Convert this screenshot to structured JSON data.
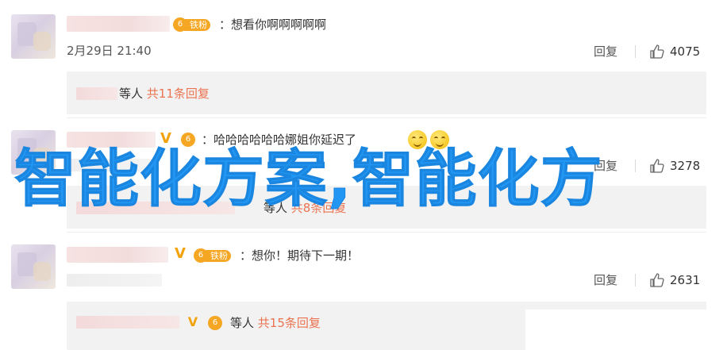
{
  "comments": [
    {
      "text": "：想看你啊啊啊啊啊",
      "time": "2月29日 21:40",
      "reply_label": "回复",
      "likes": "4075",
      "badge": "铁粉",
      "sub_replies": {
        "prefix": "等人",
        "count_text": "共11条回复"
      }
    },
    {
      "text": "：哈哈哈哈哈哈娜姐你延迟了",
      "reply_label": "回复",
      "likes": "3278",
      "sub_replies": {
        "prefix": "等人",
        "count_text": "共8条回复"
      }
    },
    {
      "text": "：想你！期待下一期！",
      "reply_label": "回复",
      "likes": "2631",
      "badge": "铁粉",
      "sub_replies": {
        "prefix": "等人",
        "count_text": "共15条回复"
      }
    }
  ],
  "watermark": "智能化方案,智能化方",
  "colors": {
    "watermark": "#2196f3",
    "reply_count": "#eb7350",
    "badge": "#f5a623",
    "verified": "#f2a20c"
  },
  "icons": [
    "verified-v-icon",
    "fan-badge-icon",
    "thumbs-up-icon",
    "laughing-emoji-icon"
  ]
}
